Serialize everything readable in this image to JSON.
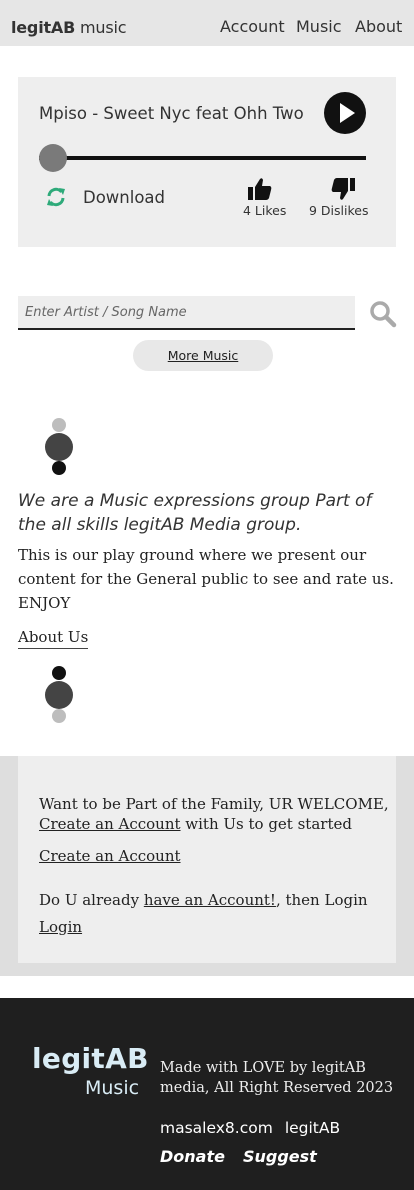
{
  "header": {
    "brand_bold": "legitAB",
    "brand_rest": " music",
    "nav": [
      "Account",
      "Music",
      "About"
    ]
  },
  "player": {
    "song_title": "Mpiso - Sweet Nyc feat Ohh Two",
    "progress": 0,
    "download_label": "Download",
    "likes_label": "4 Likes",
    "dislikes_label": "9 Dislikes",
    "icons": [
      "play-icon",
      "refresh-icon",
      "thumbs-up-icon",
      "thumbs-down-icon"
    ],
    "colors": {
      "refresh": "#2eaa7a",
      "track": "#111111"
    }
  },
  "search": {
    "placeholder": "Enter Artist / Song Name",
    "more_music_label": "More Music"
  },
  "about": {
    "tagline": "We are a Music expressions group Part of the all skills legitAB Media group.",
    "description": "This is our play ground where we present our content for the General public to see and rate us. ENJOY",
    "link_label": "About Us"
  },
  "join": {
    "intro_text": "Want to be Part of the Family, UR WELCOME,",
    "create_link_inline": "Create an Account",
    "intro_suffix": " with Us to get started",
    "create_link": "Create an Account",
    "login_prefix": "Do U already ",
    "login_link_inline": "have an Account!",
    "login_suffix": ", then Login",
    "login_link": "Login"
  },
  "footer": {
    "brand": "legitAB",
    "brand_sub": "Music",
    "made_with": "Made with LOVE by legitAB media,  All Right Reserved 2023",
    "links": [
      "masalex8.com",
      "legitAB"
    ],
    "actions": [
      "Donate",
      "Suggest"
    ]
  }
}
